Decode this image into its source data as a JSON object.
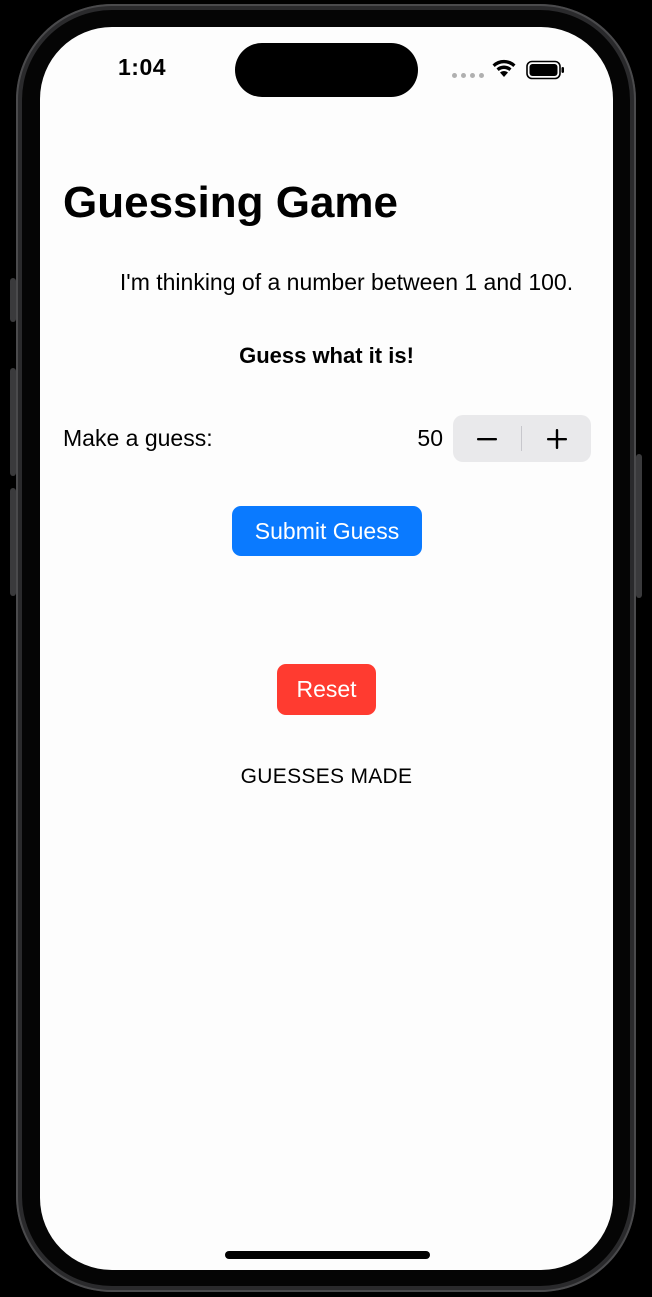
{
  "status_bar": {
    "time": "1:04",
    "icons": [
      "cellular-dots-icon",
      "wifi-icon",
      "battery-icon"
    ]
  },
  "app": {
    "title": "Guessing Game",
    "subtitle": "I'm thinking of a number between 1 and 100.",
    "prompt": "Guess what it is!",
    "guess_label": "Make a guess:",
    "guess_value": "50",
    "stepper": {
      "minus_icon": "minus-icon",
      "plus_icon": "plus-icon"
    },
    "submit_label": "Submit Guess",
    "reset_label": "Reset",
    "guesses_header": "GUESSES MADE"
  },
  "colors": {
    "submit_button": "#0A7AFF",
    "reset_button": "#FF3B30",
    "stepper_bg": "#E9E9EB",
    "screen_bg": "#FDFDFD"
  }
}
